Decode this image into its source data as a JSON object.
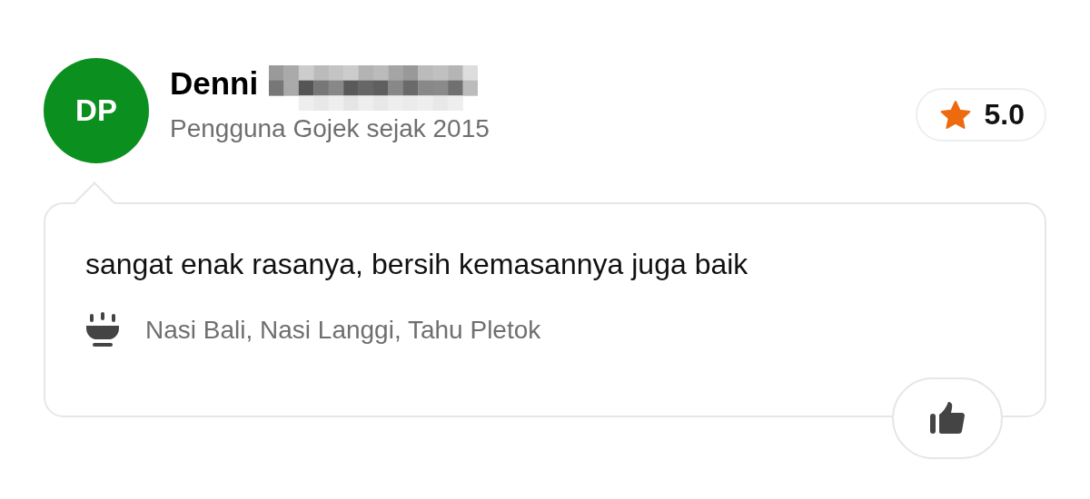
{
  "reviewer": {
    "initials": "DP",
    "name": "Denni",
    "name_redacted": true,
    "subtitle": "Pengguna Gojek sejak 2015"
  },
  "rating": "5.0",
  "review": {
    "text": "sangat enak rasanya, bersih kemasannya juga baik",
    "dishes": "Nasi Bali, Nasi Langgi, Tahu Pletok"
  },
  "like": {
    "selected": false
  }
}
